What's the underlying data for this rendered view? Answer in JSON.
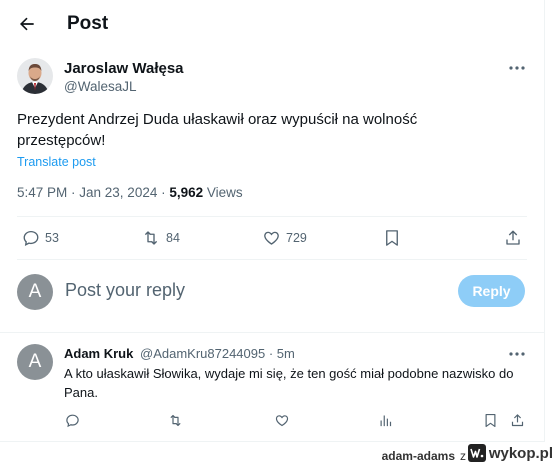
{
  "header": {
    "title": "Post"
  },
  "post": {
    "author_name": "Jaroslaw Wałęsa",
    "author_handle": "@WalesaJL",
    "text": "Prezydent Andrzej Duda ułaskawił oraz wypuścił na wolność przestępców!",
    "translate_label": "Translate post",
    "time": "5:47 PM · Jan 23, 2024 · ",
    "views_count": "5,962",
    "views_label": " Views",
    "stats": {
      "replies": "53",
      "reposts": "84",
      "likes": "729"
    }
  },
  "compose": {
    "avatar_letter": "A",
    "placeholder": "Post your reply",
    "reply_button": "Reply"
  },
  "comment": {
    "avatar_letter": "A",
    "author_name": "Adam Kruk",
    "handle_time": "@AdamKru87244095 · 5m",
    "text": "A kto ułaskawił Słowika, wydaje mi się, że ten gość miał podobne nazwisko do Pana."
  },
  "footer": {
    "user": "adam-adams",
    "separator": "z",
    "brand": "wykop.pl"
  },
  "colors": {
    "accent": "#1d9bf0",
    "reply_button_disabled": "#8ecdf7",
    "muted": "#536471"
  }
}
